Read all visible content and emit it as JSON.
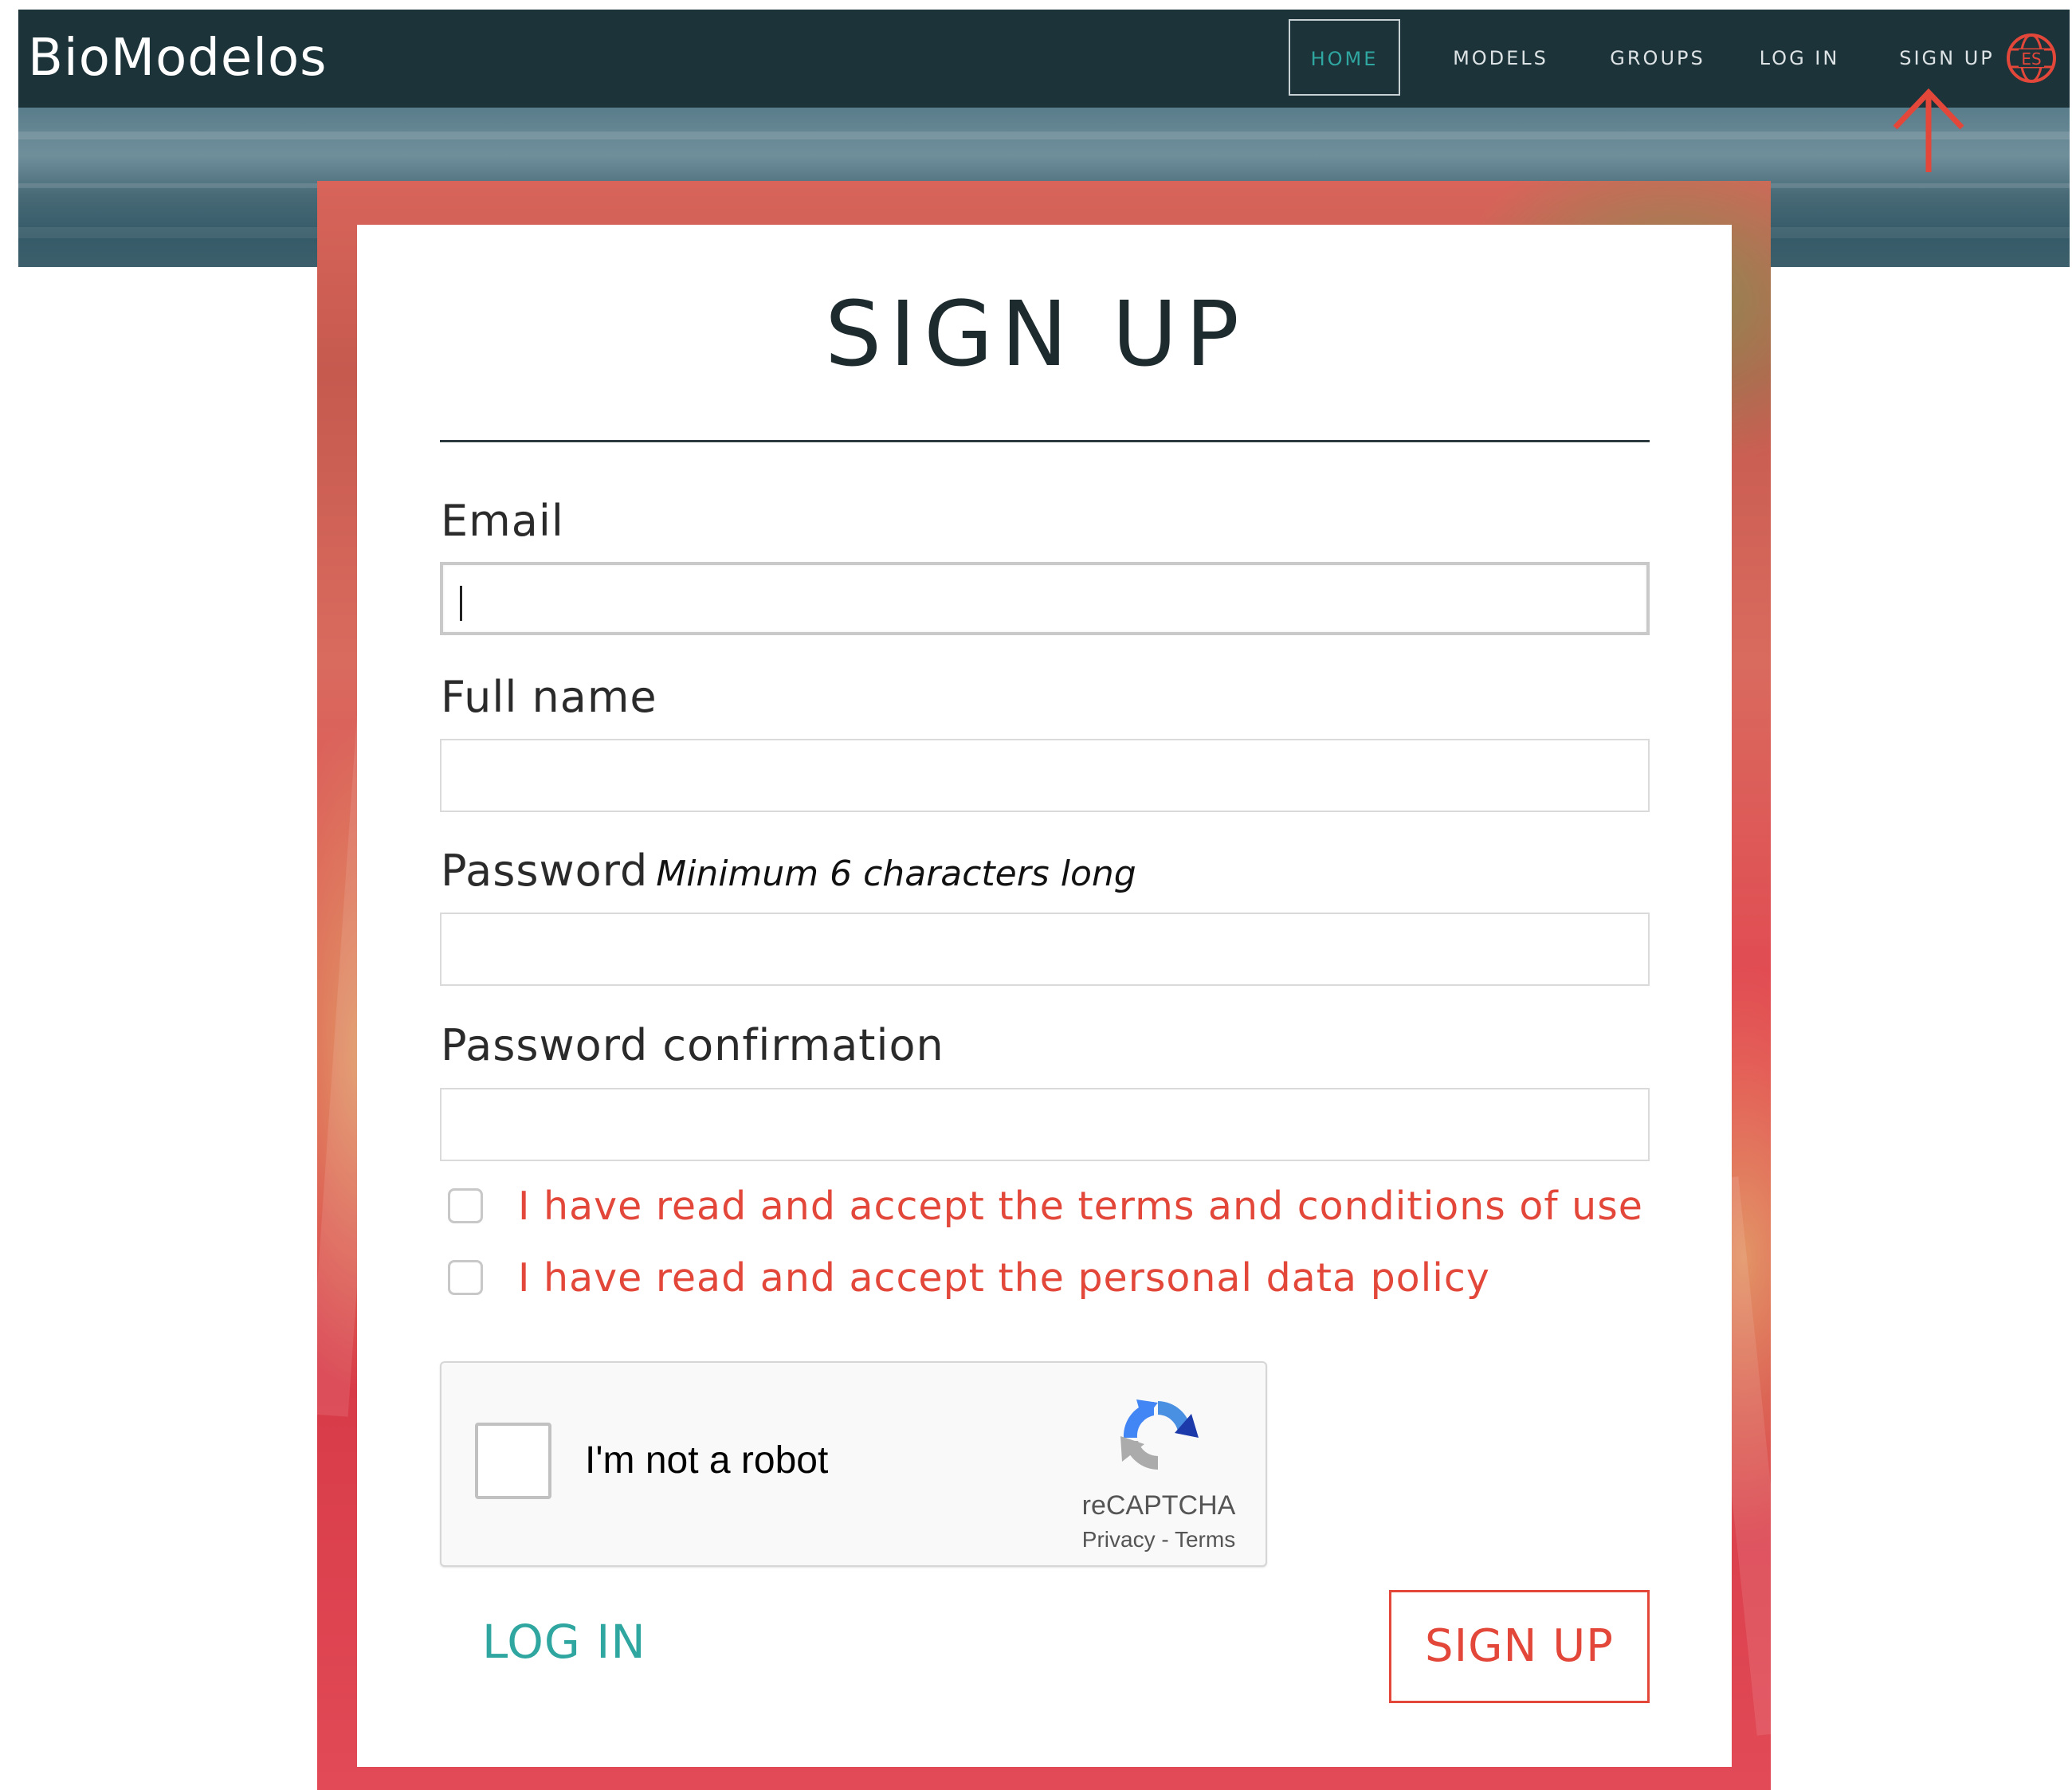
{
  "nav": {
    "brand": "BioModelos",
    "items": [
      {
        "label": "HOME",
        "active": true
      },
      {
        "label": "MODELS"
      },
      {
        "label": "GROUPS"
      },
      {
        "label": "LOG IN"
      },
      {
        "label": "SIGN UP"
      }
    ],
    "language_button": "ES"
  },
  "form": {
    "title": "SIGN UP",
    "email_label": "Email",
    "email_value": "",
    "fullname_label": "Full name",
    "fullname_value": "",
    "password_label": "Password",
    "password_hint": "Minimum 6 characters long",
    "password_value": "",
    "password_confirm_label": "Password confirmation",
    "password_confirm_value": "",
    "checkboxes": [
      {
        "label": "I have read and accept the terms and conditions of use",
        "checked": false
      },
      {
        "label": "I have read and accept the personal data policy",
        "checked": false
      }
    ],
    "captcha": {
      "label": "I'm not a robot",
      "brand": "reCAPTCHA",
      "privacy": "Privacy",
      "separator": " - ",
      "terms": "Terms",
      "checked": false
    },
    "login_link": "LOG IN",
    "submit_label": "SIGN UP"
  },
  "colors": {
    "navbar": "#1c333a",
    "accent_teal": "#2fa6a0",
    "accent_red": "#e2473a",
    "annotation_arrow": "#e2473a"
  }
}
